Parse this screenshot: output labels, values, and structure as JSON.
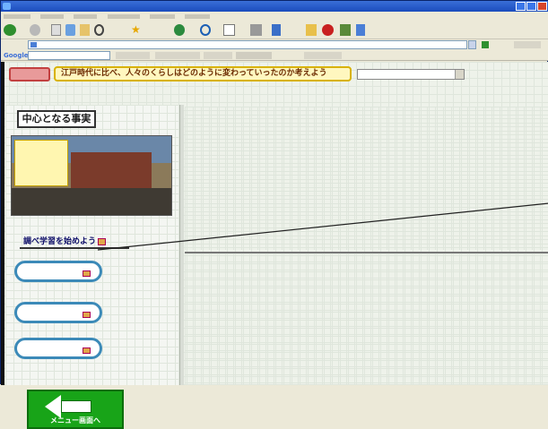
{
  "window": {
    "title": ""
  },
  "menubar": {
    "items": [
      "",
      "",
      "",
      "",
      "",
      ""
    ]
  },
  "toolbar": {
    "buttons": [
      "back",
      "forward",
      "stop",
      "refresh",
      "home",
      "search",
      "favorites",
      "media",
      "history",
      "mail",
      "print",
      "edit",
      "folder",
      "messenger"
    ]
  },
  "address": {
    "label": "",
    "value": ""
  },
  "googlebar": {
    "logo": "Google"
  },
  "header": {
    "subject": "",
    "question": "江戸時代に比べ、人々のくらしはどのように変わっていったのか考えよう",
    "select_value": ""
  },
  "left": {
    "title": "中心となる事実",
    "scene_caption": "",
    "start_label": "調べ学習を始めよう",
    "pill_1": "",
    "pill_2": "",
    "pill_3": "",
    "menu_label": "メニュー画面へ"
  },
  "colors": {
    "accent_green": "#18a418",
    "question_bg": "#fff7bf",
    "title_bar": "#1a4bbd"
  }
}
